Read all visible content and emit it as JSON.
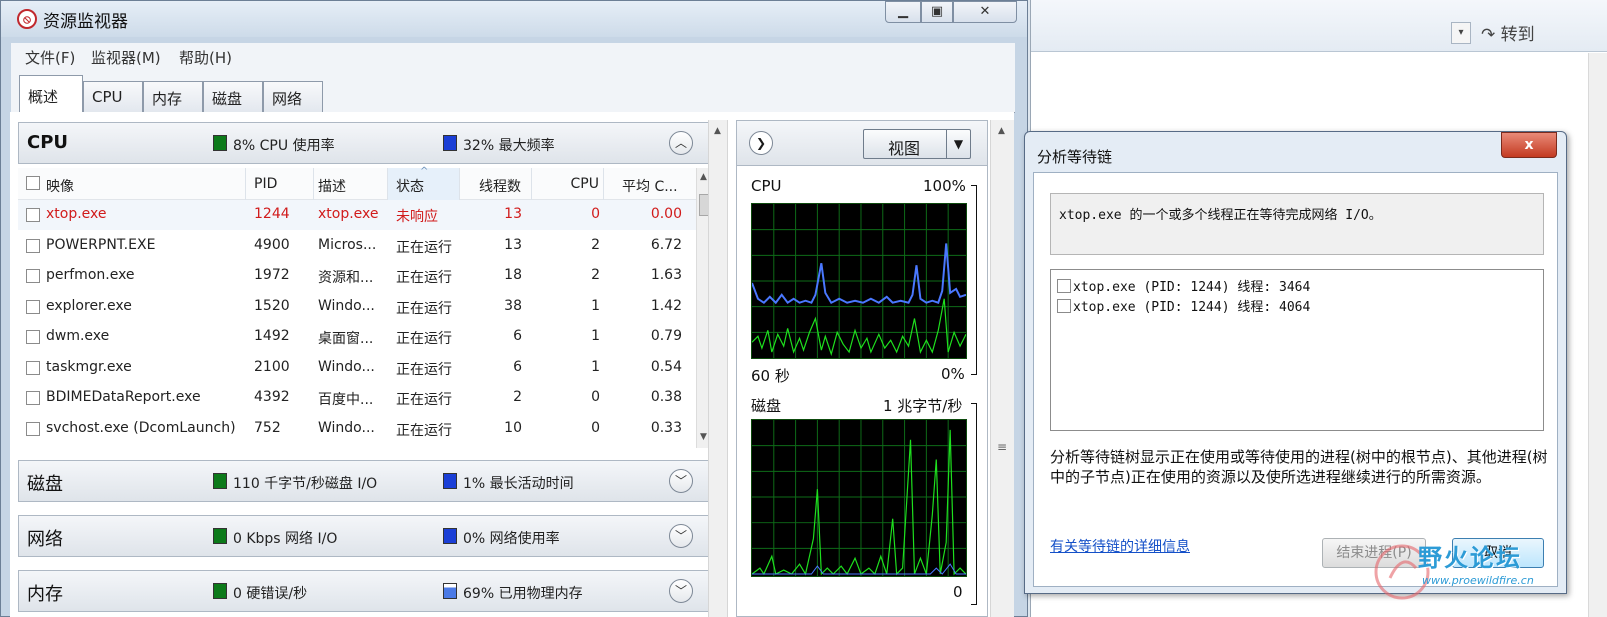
{
  "background_window": {
    "goto_label": "转到"
  },
  "window": {
    "title": "资源监视器",
    "app_icon": "resource-monitor-icon"
  },
  "menu": [
    "文件(F)",
    "监视器(M)",
    "帮助(H)"
  ],
  "tabs": [
    "概述",
    "CPU",
    "内存",
    "磁盘",
    "网络"
  ],
  "active_tab": "概述",
  "cpu_section": {
    "title": "CPU",
    "stat1": "8% CPU 使用率",
    "stat2": "32% 最大频率",
    "columns": [
      "映像",
      "PID",
      "描述",
      "状态",
      "线程数",
      "CPU",
      "平均 C..."
    ],
    "rows": [
      [
        "xtop.exe",
        "1244",
        "xtop.exe",
        "未响应",
        "13",
        "0",
        "0.00"
      ],
      [
        "POWERPNT.EXE",
        "4900",
        "Micros...",
        "正在运行",
        "13",
        "2",
        "6.72"
      ],
      [
        "perfmon.exe",
        "1972",
        "资源和...",
        "正在运行",
        "18",
        "2",
        "1.63"
      ],
      [
        "explorer.exe",
        "1520",
        "Windo...",
        "正在运行",
        "38",
        "1",
        "1.42"
      ],
      [
        "dwm.exe",
        "1492",
        "桌面窗...",
        "正在运行",
        "6",
        "1",
        "0.79"
      ],
      [
        "taskmgr.exe",
        "2100",
        "Windo...",
        "正在运行",
        "6",
        "1",
        "0.54"
      ],
      [
        "BDIMEDataReport.exe",
        "4392",
        "百度中...",
        "正在运行",
        "2",
        "0",
        "0.38"
      ],
      [
        "svchost.exe (DcomLaunch)",
        "752",
        "Windo...",
        "正在运行",
        "10",
        "0",
        "0.33"
      ]
    ]
  },
  "disk_section": {
    "title": "磁盘",
    "stat1": "110 千字节/秒磁盘 I/O",
    "stat2": "1% 最长活动时间"
  },
  "network_section": {
    "title": "网络",
    "stat1": "0 Kbps 网络 I/O",
    "stat2": "0% 网络使用率"
  },
  "memory_section": {
    "title": "内存",
    "stat1": "0 硬错误/秒",
    "stat2": "69% 已用物理内存"
  },
  "graph_panel": {
    "view_label": "视图",
    "cpu_graph": {
      "title": "CPU",
      "max_label": "100%",
      "time_label": "60 秒",
      "min_label": "0%"
    },
    "disk_graph": {
      "title": "磁盘",
      "max_label": "1 兆字节/秒",
      "min_label": "0"
    }
  },
  "dialog": {
    "title": "分析等待链",
    "close_glyph": "x",
    "message": "xtop.exe 的一个或多个线程正在等待完成网络 I/O。",
    "tree_items": [
      "xtop.exe (PID: 1244) 线程: 3464",
      "xtop.exe (PID: 1244) 线程: 4064"
    ],
    "description": "分析等待链树显示正在使用或等待使用的进程(树中的根节点)、其他进程(树中的子节点)正在使用的资源以及使所选进程继续进行的所需资源。",
    "link": "有关等待链的详细信息",
    "end_button": "结束进程(P)",
    "cancel_button": "取消"
  },
  "watermark": {
    "text": "野火论坛",
    "url": "www.proewildfire.cn"
  },
  "colors": {
    "alert_text": "#d11b1b",
    "cpu_line": "#4a78ff",
    "activity_green": "#1ee01e",
    "grid": "#0e6b18"
  }
}
